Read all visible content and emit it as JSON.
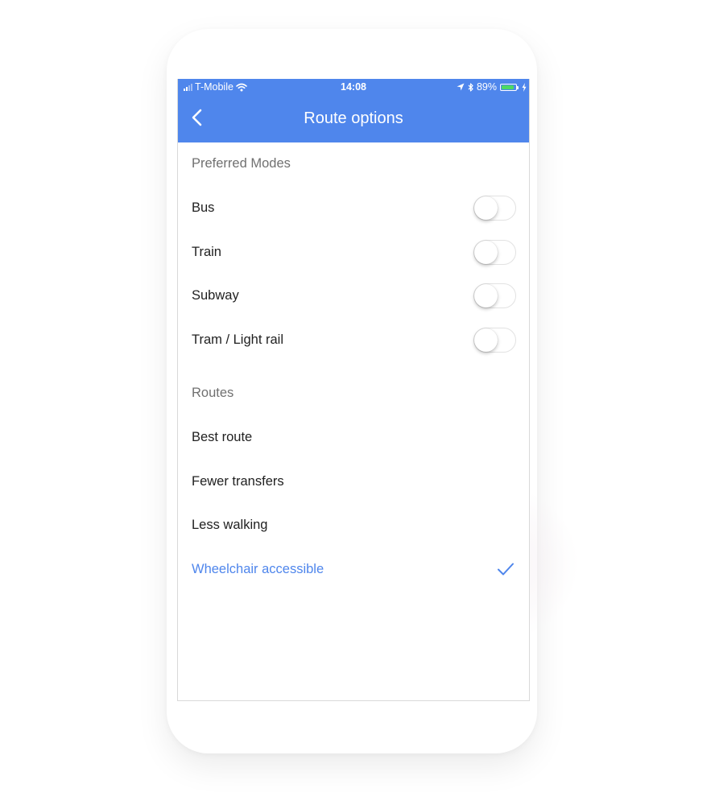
{
  "status_bar": {
    "carrier": "T-Mobile",
    "time": "14:08",
    "battery": "89%",
    "battery_level": 0.89,
    "icons": [
      "signal-icon",
      "wifi-icon",
      "location-arrow-icon",
      "bluetooth-icon",
      "battery-icon",
      "charging-icon"
    ]
  },
  "app_bar": {
    "title": "Route options",
    "back_icon": "chevron-left-icon",
    "background_color": "#4f86ec"
  },
  "preferred_modes": {
    "header": "Preferred Modes",
    "items": [
      {
        "label": "Bus",
        "enabled": false
      },
      {
        "label": "Train",
        "enabled": false
      },
      {
        "label": "Subway",
        "enabled": false
      },
      {
        "label": "Tram / Light rail",
        "enabled": false
      }
    ]
  },
  "routes": {
    "header": "Routes",
    "items": [
      {
        "label": "Best route",
        "selected": false
      },
      {
        "label": "Fewer transfers",
        "selected": false
      },
      {
        "label": "Less walking",
        "selected": false
      },
      {
        "label": "Wheelchair accessible",
        "selected": true,
        "icon": "checkmark-icon"
      }
    ]
  },
  "colors": {
    "accent": "#4f86ec",
    "text_primary": "#212121",
    "text_secondary": "#707070"
  }
}
